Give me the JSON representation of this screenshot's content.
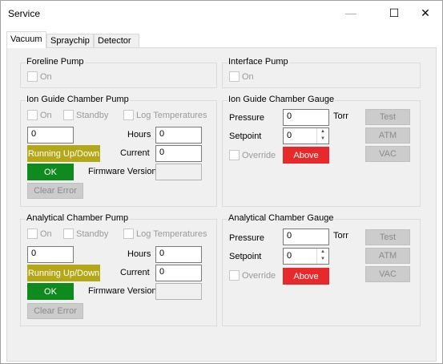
{
  "window": {
    "title": "Service",
    "minimize_glyph": "—",
    "maximize_glyph": "☐",
    "close_glyph": "✕"
  },
  "tabs": [
    {
      "label": "Vacuum",
      "active": true
    },
    {
      "label": "Spraychip",
      "active": false
    },
    {
      "label": "Detector",
      "active": false
    }
  ],
  "foreline": {
    "title": "Foreline Pump",
    "on_label": "On"
  },
  "interface": {
    "title": "Interface Pump",
    "on_label": "On"
  },
  "ion_pump": {
    "title": "Ion Guide Chamber Pump",
    "on_label": "On",
    "standby_label": "Standby",
    "log_label": "Log Temperatures",
    "speed_value": "0",
    "hours_label": "Hours",
    "hours_value": "0",
    "current_label": "Current",
    "current_value": "0",
    "status_label": "Running Up/Down",
    "ok_label": "OK",
    "firmware_label": "Firmware Version",
    "firmware_value": "",
    "clear_label": "Clear Error"
  },
  "ion_gauge": {
    "title": "Ion Guide Chamber Gauge",
    "pressure_label": "Pressure",
    "pressure_value": "0",
    "unit": "Torr",
    "setpoint_label": "Setpoint",
    "setpoint_value": "0",
    "override_label": "Override",
    "above_label": "Above",
    "test_label": "Test",
    "atm_label": "ATM",
    "vac_label": "VAC"
  },
  "an_pump": {
    "title": "Analytical Chamber Pump",
    "on_label": "On",
    "standby_label": "Standby",
    "log_label": "Log Temperatures",
    "speed_value": "0",
    "hours_label": "Hours",
    "hours_value": "0",
    "current_label": "Current",
    "current_value": "0",
    "status_label": "Running Up/Down",
    "ok_label": "OK",
    "firmware_label": "Firmware Version",
    "firmware_value": "",
    "clear_label": "Clear Error"
  },
  "an_gauge": {
    "title": "Analytical Chamber Gauge",
    "pressure_label": "Pressure",
    "pressure_value": "0",
    "unit": "Torr",
    "setpoint_label": "Setpoint",
    "setpoint_value": "0",
    "override_label": "Override",
    "above_label": "Above",
    "test_label": "Test",
    "atm_label": "ATM",
    "vac_label": "VAC"
  },
  "colors": {
    "running": "#b5a818",
    "ok": "#0e8a1e",
    "above": "#e8292b"
  }
}
